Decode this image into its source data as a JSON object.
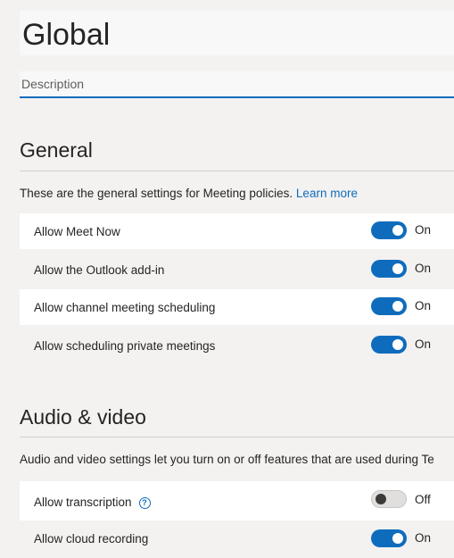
{
  "policy": {
    "title": "Global",
    "description_placeholder": "Description"
  },
  "general": {
    "heading": "General",
    "description": "These are the general settings for Meeting policies. ",
    "learn_more": "Learn more",
    "settings": [
      {
        "label": "Allow Meet Now",
        "state": "On",
        "enabled": true
      },
      {
        "label": "Allow the Outlook add-in",
        "state": "On",
        "enabled": true
      },
      {
        "label": "Allow channel meeting scheduling",
        "state": "On",
        "enabled": true
      },
      {
        "label": "Allow scheduling private meetings",
        "state": "On",
        "enabled": true
      }
    ]
  },
  "audio_video": {
    "heading": "Audio & video",
    "description": "Audio and video settings let you turn on or off features that are used during Te",
    "settings": [
      {
        "label": "Allow transcription",
        "state": "Off",
        "enabled": false,
        "help_icon": "question-circle-icon"
      },
      {
        "label": "Allow cloud recording",
        "state": "On",
        "enabled": true
      }
    ]
  },
  "colors": {
    "accent": "#0f6cbd",
    "background": "#f3f2f1"
  }
}
